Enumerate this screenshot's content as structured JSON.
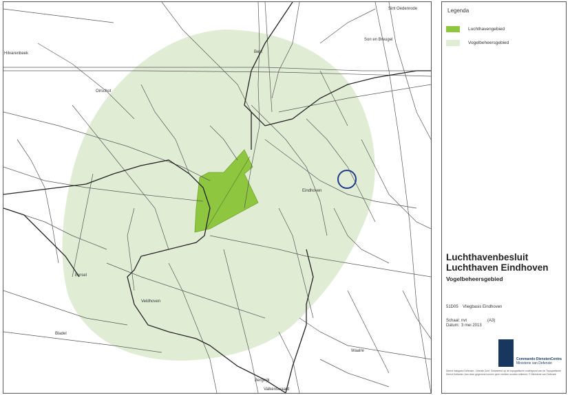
{
  "map": {
    "colors": {
      "vogelbeheersgebied": "#e0ecd4",
      "luchthavengebied": "#8ec63f",
      "roads": "#555555",
      "marker": "#1f3a8a"
    },
    "places": [
      {
        "id": "sint-oedenrode",
        "label": "Sint Oedenrode"
      },
      {
        "id": "best",
        "label": "Best"
      },
      {
        "id": "son-en-breugel",
        "label": "Son en Breugel"
      },
      {
        "id": "hilvarenbeek",
        "label": "Hilvarenbeek"
      },
      {
        "id": "oirschot",
        "label": "Oirschot"
      },
      {
        "id": "eindhoven",
        "label": "Eindhoven"
      },
      {
        "id": "eersel",
        "label": "Eersel"
      },
      {
        "id": "veldhoven",
        "label": "Veldhoven"
      },
      {
        "id": "bladel",
        "label": "Bladel"
      },
      {
        "id": "waalre",
        "label": "Waalre"
      },
      {
        "id": "bergeijk",
        "label": "Bergeijk"
      },
      {
        "id": "valkenswaard",
        "label": "Valkenswaard"
      }
    ],
    "marker_icon": "circle-marker-icon"
  },
  "legend": {
    "title": "Legenda",
    "items": [
      {
        "label": "Luchthavengebied",
        "color": "#8ec63f"
      },
      {
        "label": "Vogelbeheersgebied",
        "color": "#e0ecd4"
      }
    ]
  },
  "titleblock": {
    "title_line1": "Luchthavenbesluit",
    "title_line2": "Luchthaven Eindhoven",
    "subtitle": "Vogelbeheersgebied",
    "code": "51D05",
    "base_name": "Vliegbasis Eindhoven",
    "scale_label": "Schaal:",
    "scale_value": "nvt",
    "paper_size": "(A3)",
    "date_label": "Datum:",
    "date_value": "3 mei 2013",
    "logo_line1": "Commando DienstenCentra",
    "logo_line2": "Ministerie van Defensie",
    "disclaimer": "Dienst Vastgoed Defensie - Directie Zuid. Gebaseerd op de topografische ondergrond van de Topografische Dienst Kadaster. Aan deze gegevens kunnen geen rechten worden ontleend. © Ministerie van Defensie"
  }
}
